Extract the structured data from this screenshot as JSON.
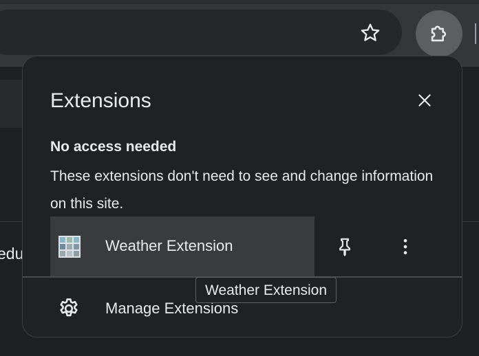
{
  "popup": {
    "title": "Extensions",
    "close_icon": "close-icon",
    "section": {
      "heading": "No access needed",
      "description": "These extensions don't need to see and change information on this site."
    },
    "extensions": [
      {
        "name": "Weather Extension",
        "icon": "weather-extension-icon",
        "pin_icon": "pin-icon",
        "more_icon": "more-vert-icon"
      }
    ],
    "manage": {
      "label": "Manage Extensions",
      "icon": "gear-icon"
    }
  },
  "tooltip": {
    "text": "Weather Extension"
  },
  "toolbar": {
    "bookmark_icon": "star-icon",
    "extensions_icon": "puzzle-icon"
  },
  "page": {
    "visible_text": "edu"
  },
  "colors": {
    "popup_background": "#202124",
    "hover_row": "#3a3b3e",
    "text": "#e8eaed",
    "extension_button_active": "#5c5e62"
  }
}
